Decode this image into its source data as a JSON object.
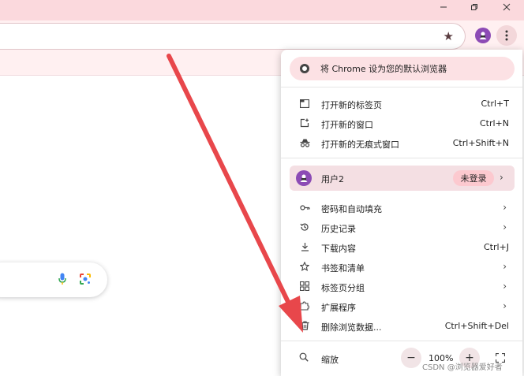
{
  "window": {
    "minimize_icon": "minimize-icon",
    "restore_icon": "restore-icon",
    "close_icon": "close-icon",
    "titlebar_color": "#fbd9dd"
  },
  "menu": {
    "promo": "将 Chrome 设为您的默认浏览器",
    "items_group1": [
      {
        "label": "打开新的标签页",
        "shortcut": "Ctrl+T",
        "icon": "new-tab-icon"
      },
      {
        "label": "打开新的窗口",
        "shortcut": "Ctrl+N",
        "icon": "new-window-icon"
      },
      {
        "label": "打开新的无痕式窗口",
        "shortcut": "Ctrl+Shift+N",
        "icon": "incognito-icon"
      }
    ],
    "profile": {
      "label": "用户2",
      "status": "未登录"
    },
    "items_group2": [
      {
        "label": "密码和自动填充",
        "icon": "key-icon"
      },
      {
        "label": "历史记录",
        "icon": "history-icon"
      },
      {
        "label": "下载内容",
        "shortcut": "Ctrl+J",
        "icon": "download-icon"
      },
      {
        "label": "书签和清单",
        "icon": "star-icon"
      },
      {
        "label": "标签页分组",
        "icon": "tab-groups-icon"
      },
      {
        "label": "扩展程序",
        "icon": "extension-icon"
      },
      {
        "label": "删除浏览数据...",
        "shortcut": "Ctrl+Shift+Del",
        "icon": "trash-icon"
      }
    ],
    "zoom": {
      "label": "缩放",
      "value": "100%",
      "minus": "−",
      "plus": "+"
    }
  },
  "watermark": "CSDN @浏览器爱好者",
  "colors": {
    "accent": "#8c4bb5",
    "annotation_arrow": "#e8474b",
    "promo_bg": "#fce1e4"
  }
}
